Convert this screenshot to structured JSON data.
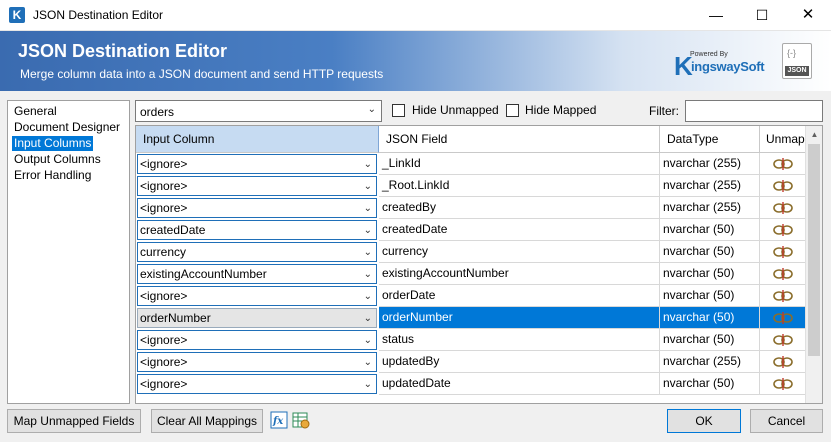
{
  "window": {
    "title": "JSON Destination Editor",
    "icon_letter": "K"
  },
  "banner": {
    "title": "JSON Destination Editor",
    "subtitle": "Merge column data into a JSON document and send HTTP requests",
    "logo_powered": "Powered By",
    "logo_k": "K",
    "logo_name": "ingswaySoft",
    "json_badge": "JSON",
    "json_top": "{-}"
  },
  "nav": {
    "items": [
      {
        "label": "General"
      },
      {
        "label": "Document Designer"
      },
      {
        "label": "Input Columns",
        "selected": true
      },
      {
        "label": "Output Columns"
      },
      {
        "label": "Error Handling"
      }
    ]
  },
  "toolbar": {
    "table_value": "orders",
    "hide_unmapped": "Hide Unmapped",
    "hide_mapped": "Hide Mapped",
    "filter_label": "Filter:",
    "filter_value": ""
  },
  "grid": {
    "headers": {
      "input": "Input Column",
      "field": "JSON Field",
      "type": "DataType",
      "unmap": "Unmap"
    },
    "rows": [
      {
        "input": "<ignore>",
        "field": "_LinkId",
        "type": "nvarchar (255)"
      },
      {
        "input": "<ignore>",
        "field": "_Root.LinkId",
        "type": "nvarchar (255)"
      },
      {
        "input": "<ignore>",
        "field": "createdBy",
        "type": "nvarchar (255)"
      },
      {
        "input": "createdDate",
        "field": "createdDate",
        "type": "nvarchar (50)"
      },
      {
        "input": "currency",
        "field": "currency",
        "type": "nvarchar (50)"
      },
      {
        "input": "existingAccountNumber",
        "field": "existingAccountNumber",
        "type": "nvarchar (50)"
      },
      {
        "input": "<ignore>",
        "field": "orderDate",
        "type": "nvarchar (50)"
      },
      {
        "input": "orderNumber",
        "field": "orderNumber",
        "type": "nvarchar (50)",
        "selected": true
      },
      {
        "input": "<ignore>",
        "field": "status",
        "type": "nvarchar (50)"
      },
      {
        "input": "<ignore>",
        "field": "updatedBy",
        "type": "nvarchar (255)"
      },
      {
        "input": "<ignore>",
        "field": "updatedDate",
        "type": "nvarchar (50)"
      }
    ]
  },
  "buttons": {
    "map_unmapped": "Map Unmapped Fields",
    "clear_all": "Clear All Mappings",
    "ok": "OK",
    "cancel": "Cancel"
  },
  "window_buttons": {
    "minimize": "—",
    "maximize": "☐",
    "close": "✕"
  }
}
